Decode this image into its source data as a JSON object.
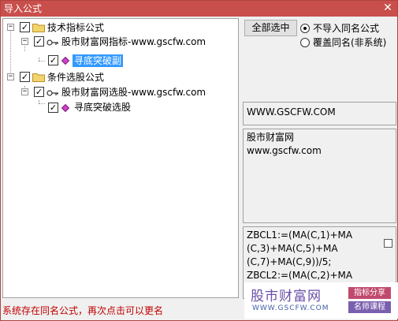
{
  "window": {
    "title": "导入公式",
    "close_glyph": "✕"
  },
  "tree": {
    "nodes": [
      {
        "label": "技术指标公式",
        "expander": "−",
        "checked": "✓"
      },
      {
        "label": "股市财富网指标-www.gscfw.com",
        "expander": "−",
        "checked": "✓"
      },
      {
        "label": "寻底突破副",
        "checked": "✓",
        "selected": true
      },
      {
        "label": "条件选股公式",
        "expander": "−",
        "checked": "✓"
      },
      {
        "label": "股市财富网选股-www.gscfw.com",
        "expander": "−",
        "checked": "✓"
      },
      {
        "label": "寻底突破选股",
        "checked": "✓"
      }
    ]
  },
  "controls": {
    "select_all_button": "全部选中",
    "radio_no_import": "不导入同名公式",
    "radio_overwrite": "覆盖同名(非系统)"
  },
  "info": {
    "url": "WWW.GSCFW.COM",
    "desc_line1": "股市财富网",
    "desc_line2": "www.gscfw.com",
    "code_line1": "ZBCL1:=(MA(C,1)+MA",
    "code_line2": "(C,3)+MA(C,5)+MA",
    "code_line3": "(C,7)+MA(C,9))/5;",
    "code_line4": "ZBCL2:=(MA(C,2)+MA"
  },
  "watermark": {
    "title": "股市财富网",
    "url": "WWW.GSCFW.COM",
    "tag1": "指标分享",
    "tag2": "名师课程"
  },
  "status": {
    "message": "系统存在同名公式，再次点击可以更名"
  },
  "colors": {
    "titlebar": "#c94f4c",
    "selection": "#3399ff",
    "status_text": "#c00000",
    "folder": "#e8c25a"
  }
}
